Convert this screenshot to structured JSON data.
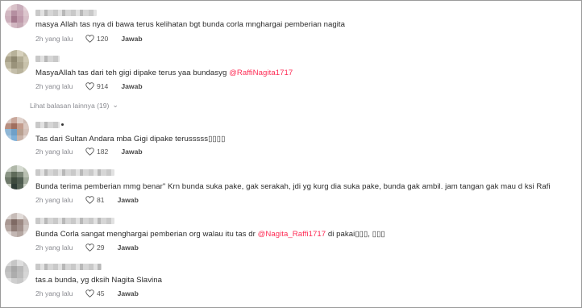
{
  "comments": [
    {
      "text": "masya Allah tas nya di bawa terus kelihatan bgt bunda corla mnghargai pemberian nagita",
      "mention": "",
      "suffix": "",
      "time": "2h yang lalu",
      "likes": "120",
      "reply": "Jawab"
    },
    {
      "text": "MasyaAllah tas dari teh gigi dipake terus yaa bundasyg ",
      "mention": "@RaffiNagita1717",
      "suffix": "",
      "time": "2h yang lalu",
      "likes": "914",
      "reply": "Jawab"
    },
    {
      "text": "Tas dari Sultan Andara mba Gigi dipake terusssss▯▯▯▯",
      "mention": "",
      "suffix": "",
      "time": "2h yang lalu",
      "likes": "182",
      "reply": "Jawab"
    },
    {
      "text": "Bunda terima pemberian mmg benar\" Krn bunda suka pake, gak serakah, jdi yg kurg dia suka pake, bunda gak ambil. jam tangan gak mau d ksi Rafi",
      "mention": "",
      "suffix": "",
      "time": "2h yang lalu",
      "likes": "81",
      "reply": "Jawab"
    },
    {
      "text": "Bunda Corla sangat menghargai pemberian org walau itu tas dr ",
      "mention": "@Nagita_Raffi1717",
      "suffix": " di pakai▯▯▯, ▯▯▯",
      "time": "2h yang lalu",
      "likes": "29",
      "reply": "Jawab"
    },
    {
      "text": "tas.a bunda, yg dksih Nagita Slavina",
      "mention": "",
      "suffix": "",
      "time": "2h yang lalu",
      "likes": "45",
      "reply": "Jawab"
    }
  ],
  "more_replies": "Lihat balasan lainnya (19)",
  "colors": {
    "mention": "#fe2c55",
    "meta": "#8a8b91"
  },
  "icons": {
    "like": "heart-outline-icon",
    "more": "chevron-down-icon"
  }
}
